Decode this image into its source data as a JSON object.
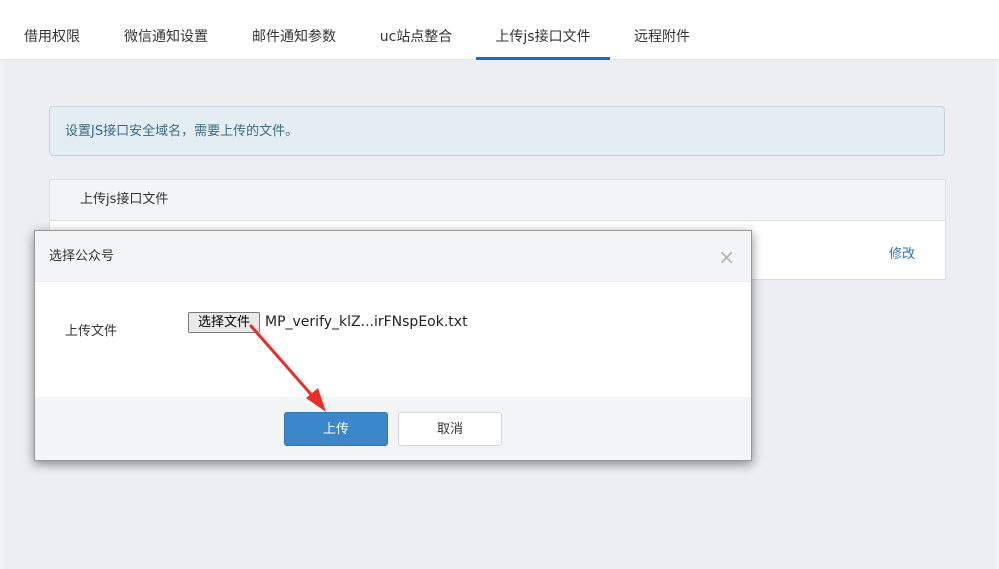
{
  "tabs": [
    {
      "label": "借用权限"
    },
    {
      "label": "微信通知设置"
    },
    {
      "label": "邮件通知参数"
    },
    {
      "label": "uc站点整合"
    },
    {
      "label": "上传js接口文件",
      "active": true
    },
    {
      "label": "远程附件"
    }
  ],
  "alert": {
    "text": "设置JS接口安全域名，需要上传的文件。"
  },
  "panel": {
    "header": "上传js接口文件",
    "edit_label": "修改"
  },
  "modal": {
    "title": "选择公众号",
    "close": "×",
    "field_label": "上传文件",
    "file_button_label": "选择文件",
    "file_name": "MP_verify_klZ...irFNspEok.txt",
    "upload_label": "上传",
    "cancel_label": "取消"
  },
  "colors": {
    "accent": "#3b87c9",
    "tab_active": "#1f6fb5",
    "arrow": "#e8302a"
  }
}
